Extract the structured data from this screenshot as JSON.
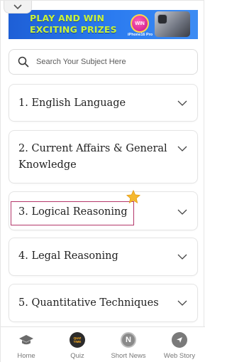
{
  "banner": {
    "line1": "PLAY AND WIN",
    "line2": "EXCITING PRIZES",
    "badge": "WIN",
    "phone_label": "iPhone16 Pro"
  },
  "search": {
    "placeholder": "Search Your Subject Here"
  },
  "subjects": [
    {
      "label": "1. English Language"
    },
    {
      "label": "2. Current Affairs & General",
      "label_line2": "Knowledge"
    },
    {
      "label": "3. Logical Reasoning"
    },
    {
      "label": "4. Legal Reasoning"
    },
    {
      "label": "5. Quantitative Techniques"
    }
  ],
  "bottom_nav": [
    {
      "label": "Home",
      "icon": "graduation-cap-icon"
    },
    {
      "label": "Quiz",
      "icon": "quiz-time-icon",
      "badge": "QUIZ TIME"
    },
    {
      "label": "Short News",
      "icon": "news-n-icon",
      "badge": "N"
    },
    {
      "label": "Web Story",
      "icon": "compass-icon"
    }
  ],
  "colors": {
    "highlight": "#b4376a",
    "star": "#f5b82e",
    "text": "#1f1f1f",
    "nav_label": "#777777"
  }
}
